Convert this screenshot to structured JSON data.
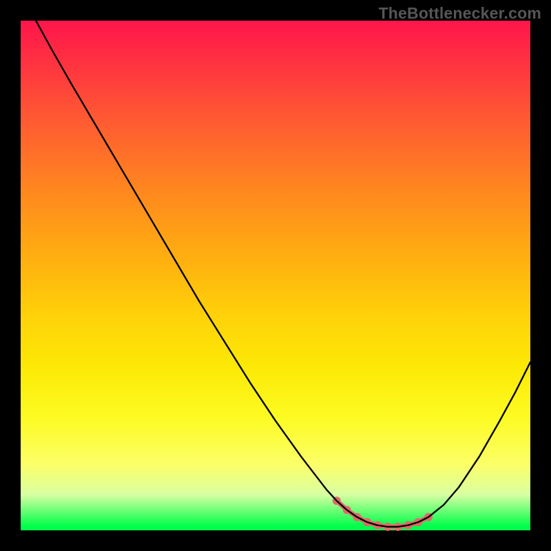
{
  "watermark": "TheBottlenecker.com",
  "chart_data": {
    "type": "line",
    "title": "",
    "xlabel": "",
    "ylabel": "",
    "xlim": [
      0,
      100
    ],
    "ylim": [
      0,
      100
    ],
    "x": [
      0,
      3,
      6,
      10,
      15,
      20,
      25,
      30,
      35,
      40,
      45,
      50,
      55,
      60,
      62,
      64,
      66,
      68,
      70,
      72,
      74,
      76,
      78,
      80,
      83,
      86,
      90,
      94,
      97,
      100
    ],
    "values": [
      108,
      100,
      94.5,
      87.5,
      79,
      70.5,
      62,
      53.5,
      45,
      37,
      29,
      21.5,
      14.5,
      8,
      5.8,
      4.0,
      2.6,
      1.6,
      1.0,
      0.7,
      0.7,
      1.0,
      1.6,
      2.6,
      5.0,
      8.5,
      14.5,
      21.5,
      27,
      33
    ],
    "background_gradient": {
      "direction": "vertical",
      "stops": [
        {
          "pos": 0.0,
          "color": "#ff154b"
        },
        {
          "pos": 0.18,
          "color": "#ff5534"
        },
        {
          "pos": 0.33,
          "color": "#ff861f"
        },
        {
          "pos": 0.46,
          "color": "#ffad10"
        },
        {
          "pos": 0.58,
          "color": "#ffd209"
        },
        {
          "pos": 0.68,
          "color": "#fce905"
        },
        {
          "pos": 0.78,
          "color": "#fdfb23"
        },
        {
          "pos": 0.87,
          "color": "#fcff67"
        },
        {
          "pos": 0.93,
          "color": "#d8ffa2"
        },
        {
          "pos": 1.0,
          "color": "#00ff4a"
        }
      ]
    },
    "curve_color": "#000000",
    "highlight": {
      "color": "#e16a6a",
      "x": [
        62,
        64,
        66,
        68,
        70,
        72,
        74,
        76,
        78,
        80
      ],
      "y": [
        5.8,
        4.0,
        2.6,
        1.6,
        1.0,
        0.7,
        0.7,
        1.0,
        1.6,
        2.6
      ],
      "point_radius_px": 6
    }
  }
}
